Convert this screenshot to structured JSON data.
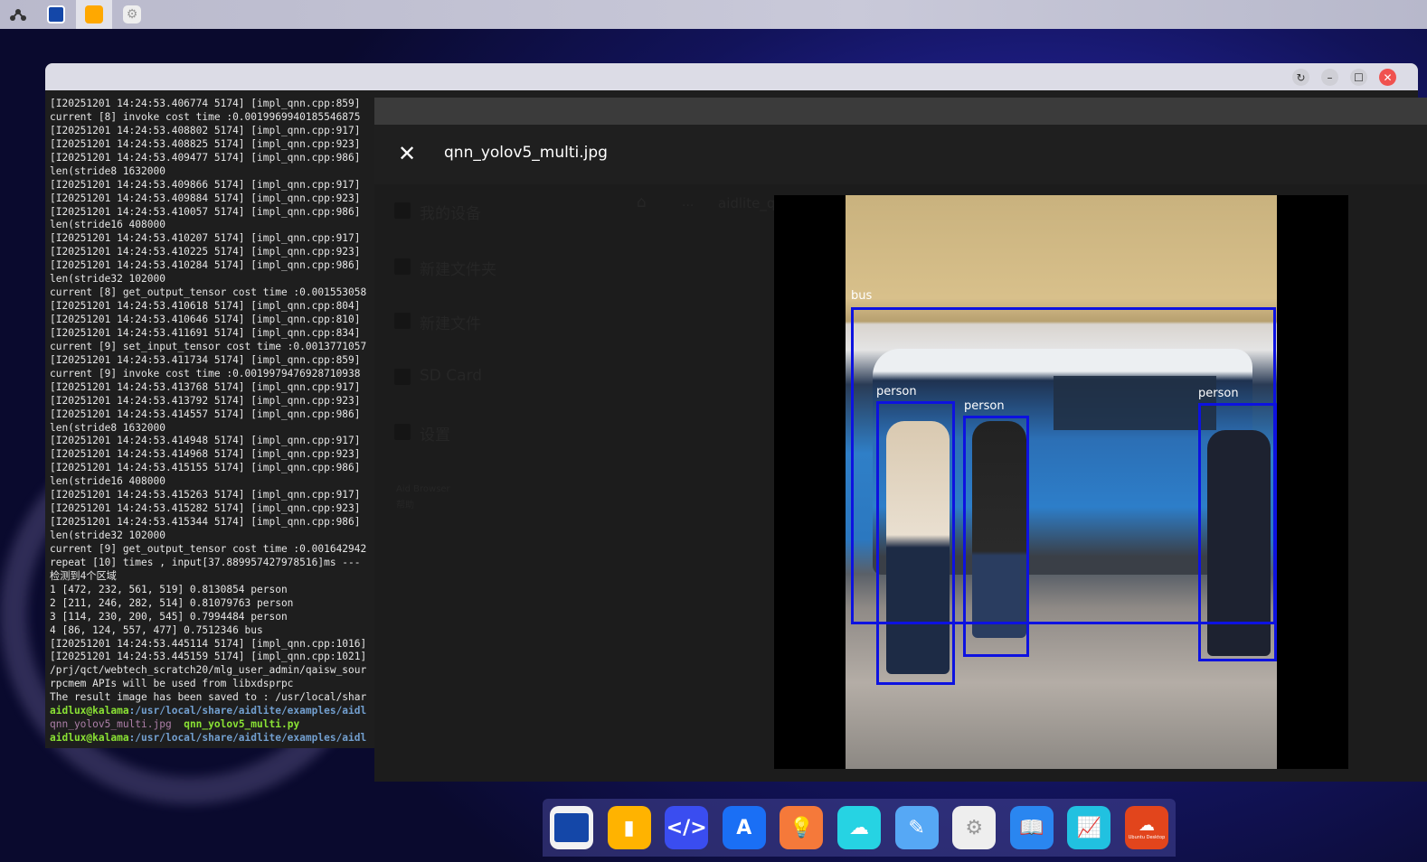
{
  "topbar": {
    "items": [
      {
        "icon": "aidlux-logo-icon"
      },
      {
        "icon": "terminal-icon"
      },
      {
        "icon": "files-icon",
        "active": true
      },
      {
        "icon": "settings-icon"
      }
    ]
  },
  "terminal": {
    "window_buttons": {
      "refresh": "↻",
      "minimize": "–",
      "maximize": "☐",
      "close": "✕"
    },
    "lines": [
      "[I20251201 14:24:53.406774 5174] [impl_qnn.cpp:859]",
      "current [8] invoke cost time :0.0019969940185546875",
      "[I20251201 14:24:53.408802 5174] [impl_qnn.cpp:917]",
      "[I20251201 14:24:53.408825 5174] [impl_qnn.cpp:923]",
      "[I20251201 14:24:53.409477 5174] [impl_qnn.cpp:986]",
      "len(stride8 1632000",
      "[I20251201 14:24:53.409866 5174] [impl_qnn.cpp:917]",
      "[I20251201 14:24:53.409884 5174] [impl_qnn.cpp:923]",
      "[I20251201 14:24:53.410057 5174] [impl_qnn.cpp:986]",
      "len(stride16 408000",
      "[I20251201 14:24:53.410207 5174] [impl_qnn.cpp:917]",
      "[I20251201 14:24:53.410225 5174] [impl_qnn.cpp:923]",
      "[I20251201 14:24:53.410284 5174] [impl_qnn.cpp:986]",
      "len(stride32 102000",
      "current [8] get_output_tensor cost time :0.001553058",
      "[I20251201 14:24:53.410618 5174] [impl_qnn.cpp:804]",
      "[I20251201 14:24:53.410646 5174] [impl_qnn.cpp:810]",
      "[I20251201 14:24:53.411691 5174] [impl_qnn.cpp:834]",
      "current [9] set_input_tensor cost time :0.0013771057",
      "[I20251201 14:24:53.411734 5174] [impl_qnn.cpp:859]",
      "current [9] invoke cost time :0.0019979476928710938",
      "[I20251201 14:24:53.413768 5174] [impl_qnn.cpp:917]",
      "[I20251201 14:24:53.413792 5174] [impl_qnn.cpp:923]",
      "[I20251201 14:24:53.414557 5174] [impl_qnn.cpp:986]",
      "len(stride8 1632000",
      "[I20251201 14:24:53.414948 5174] [impl_qnn.cpp:917]",
      "[I20251201 14:24:53.414968 5174] [impl_qnn.cpp:923]",
      "[I20251201 14:24:53.415155 5174] [impl_qnn.cpp:986]",
      "len(stride16 408000",
      "[I20251201 14:24:53.415263 5174] [impl_qnn.cpp:917]",
      "[I20251201 14:24:53.415282 5174] [impl_qnn.cpp:923]",
      "[I20251201 14:24:53.415344 5174] [impl_qnn.cpp:986]",
      "len(stride32 102000",
      "current [9] get_output_tensor cost time :0.001642942",
      "repeat [10] times , input[37.889957427978516]ms ---",
      "检测到4个区域",
      "1 [472, 232, 561, 519] 0.8130854 person",
      "2 [211, 246, 282, 514] 0.81079763 person",
      "3 [114, 230, 200, 545] 0.7994484 person",
      "4 [86, 124, 557, 477] 0.7512346 bus",
      "[I20251201 14:24:53.445114 5174] [impl_qnn.cpp:1016]",
      "[I20251201 14:24:53.445159 5174] [impl_qnn.cpp:1021]",
      "/prj/qct/webtech_scratch20/mlg_user_admin/qaisw_sour",
      "rpcmem APIs will be used from libxdsprpc",
      "The result image has been saved to : /usr/local/shar"
    ],
    "prompt1": {
      "user": "aidlux@kalama",
      "path": ":/usr/local/share/aidlite/examples/aidl"
    },
    "ls": {
      "file1": "qnn_yolov5_multi.jpg",
      "file2": "qnn_yolov5_multi.py"
    },
    "prompt2": {
      "user": "aidlux@kalama",
      "path": ":/usr/local/share/aidlite/examples/aidl"
    }
  },
  "file_manager_bg": {
    "sidebar": [
      "我的设备",
      "新建文件夹",
      "新建文件",
      "SD Card",
      "设置"
    ],
    "footer": [
      "Aid Browser",
      "帮助"
    ],
    "breadcrumb": [
      "...",
      "aidlite_qi"
    ]
  },
  "viewer": {
    "title": "qnn_yolov5_multi.jpg",
    "close": "✕",
    "detections": [
      {
        "label": "bus"
      },
      {
        "label": "person"
      },
      {
        "label": "person"
      },
      {
        "label": "person"
      }
    ],
    "box_color": "#0d12e0"
  },
  "dock": {
    "items": [
      {
        "icon": "terminal-icon",
        "color": "#f2f2f2"
      },
      {
        "icon": "files-icon",
        "color": "#ffb300"
      },
      {
        "icon": "code-editor-icon",
        "color": "#3a4df0"
      },
      {
        "icon": "app-store-icon",
        "color": "#1a6ff5"
      },
      {
        "icon": "lightbulb-icon",
        "color": "#f5793a"
      },
      {
        "icon": "cloud-icon",
        "color": "#26d3e3"
      },
      {
        "icon": "tools-icon",
        "color": "#56a8f5"
      },
      {
        "icon": "system-settings-icon",
        "color": "#eeeeee"
      },
      {
        "icon": "docs-book-icon",
        "color": "#2a86f0"
      },
      {
        "icon": "monitor-icon",
        "color": "#21c1e0"
      },
      {
        "icon": "ubuntu-desktop-icon",
        "color": "#e2451c",
        "label": "Ubuntu Desktop"
      }
    ]
  }
}
